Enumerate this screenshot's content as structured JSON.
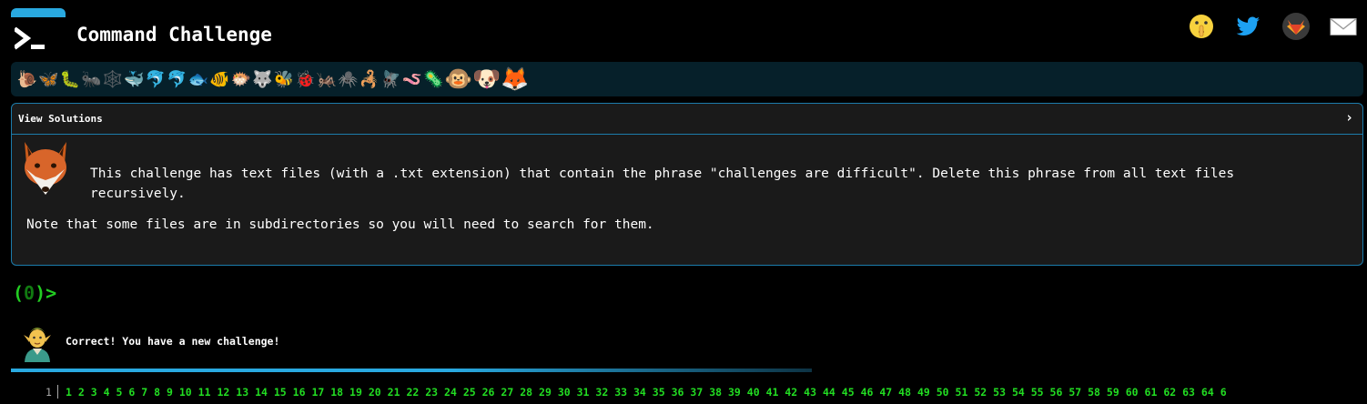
{
  "header": {
    "title": "Command Challenge",
    "social": [
      "shush-emoji-icon",
      "twitter-icon",
      "gitlab-icon",
      "mail-icon"
    ]
  },
  "emoji_bar": {
    "items": [
      "🐌",
      "🦋",
      "🐛",
      "🐜",
      "🕸️",
      "🐳",
      "🐬",
      "🐬",
      "🐟",
      "🐠",
      "🐡",
      "🐺",
      "🐝",
      "🐞",
      "🦗",
      "🕷️",
      "🦂",
      "🪰",
      "🪱",
      "🦠",
      "🐵",
      "🐶",
      "🦊"
    ]
  },
  "panel": {
    "header_label": "View Solutions",
    "chevron": "›",
    "challenge": "This challenge has text files (with a .txt extension) that contain the phrase \"challenges are difficult\". Delete this phrase from all text files recursively.",
    "note": "Note that some files are in subdirectories so you will need to search for them."
  },
  "prompt": {
    "open": "(",
    "count": "0",
    "close": ")>"
  },
  "result": {
    "message": "Correct! You have a new challenge!"
  },
  "progress": {
    "current_level": "1",
    "fraction": 0.55
  },
  "levels": [
    "1",
    "2",
    "3",
    "4",
    "5",
    "6",
    "7",
    "8",
    "9",
    "10",
    "11",
    "12",
    "13",
    "14",
    "15",
    "16",
    "17",
    "18",
    "19",
    "20",
    "21",
    "22",
    "23",
    "24",
    "25",
    "26",
    "27",
    "28",
    "29",
    "30",
    "31",
    "32",
    "33",
    "34",
    "35",
    "36",
    "37",
    "38",
    "39",
    "40",
    "41",
    "42",
    "43",
    "44",
    "45",
    "46",
    "47",
    "48",
    "49",
    "50",
    "51",
    "52",
    "53",
    "54",
    "55",
    "56",
    "57",
    "58",
    "59",
    "60",
    "61",
    "62",
    "63",
    "64",
    "6"
  ],
  "colors": {
    "accent": "#29a9e0",
    "prompt_green": "#22cc22",
    "panel_border": "#1c7cab",
    "panel_bg": "#1a1a1a",
    "emoji_bar_bg": "#06202a"
  }
}
